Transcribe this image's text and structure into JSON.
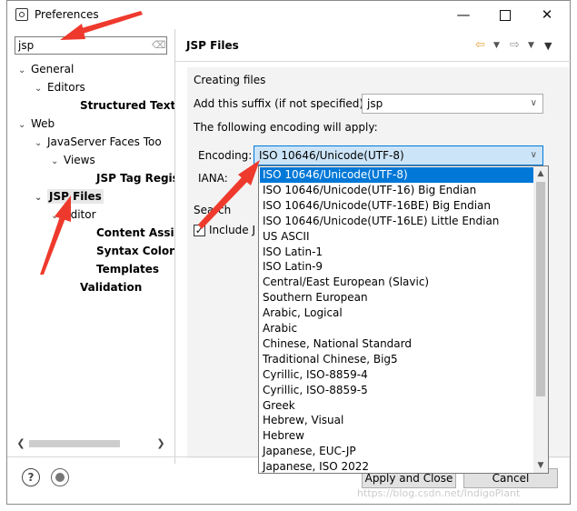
{
  "window": {
    "title": "Preferences",
    "minimize_label": "—",
    "close_label": "✕"
  },
  "filter": {
    "value": "jsp"
  },
  "tree": [
    {
      "label": "General",
      "twisty": "v",
      "bold": false
    },
    {
      "label": "Editors",
      "twisty": "v",
      "bold": false
    },
    {
      "label": "Structured Text E",
      "twisty": "",
      "bold": true
    },
    {
      "label": "Web",
      "twisty": "v",
      "bold": false
    },
    {
      "label": "JavaServer Faces Too",
      "twisty": "v",
      "bold": false
    },
    {
      "label": "Views",
      "twisty": "v",
      "bold": false
    },
    {
      "label": "JSP Tag Regis",
      "twisty": "",
      "bold": true
    },
    {
      "label": "JSP Files",
      "twisty": "v",
      "bold": true
    },
    {
      "label": "Editor",
      "twisty": "v",
      "bold": false
    },
    {
      "label": "Content Assis",
      "twisty": "",
      "bold": true
    },
    {
      "label": "Syntax Colorin",
      "twisty": "",
      "bold": true
    },
    {
      "label": "Templates",
      "twisty": "",
      "bold": true
    },
    {
      "label": "Validation",
      "twisty": "",
      "bold": true
    }
  ],
  "page": {
    "title": "JSP Files",
    "creating_files_label": "Creating files",
    "suffix_label": "Add this suffix (if not specified):",
    "suffix_value": "jsp",
    "encoding_info": "The following encoding will apply:",
    "encoding_label": "Encoding:",
    "encoding_value": "ISO 10646/Unicode(UTF-8)",
    "iana_label": "IANA:",
    "search_label": "Search",
    "include_label": "Include J",
    "apply_close_label": "Apply and Close",
    "cancel_label": "Cancel"
  },
  "encoding_options": [
    "ISO 10646/Unicode(UTF-8)",
    "ISO 10646/Unicode(UTF-16) Big Endian",
    "ISO 10646/Unicode(UTF-16BE) Big Endian",
    "ISO 10646/Unicode(UTF-16LE) Little Endian",
    "US ASCII",
    "ISO Latin-1",
    "ISO Latin-9",
    "Central/East European (Slavic)",
    "Southern European",
    "Arabic, Logical",
    "Arabic",
    "Chinese, National Standard",
    "Traditional Chinese, Big5",
    "Cyrillic, ISO-8859-4",
    "Cyrillic, ISO-8859-5",
    "Greek",
    "Hebrew, Visual",
    "Hebrew",
    "Japanese, EUC-JP",
    "Japanese, ISO 2022"
  ],
  "selected_encoding_index": 0,
  "watermark": "https://blog.csdn.net/IndigoPlant",
  "colors": {
    "selection": "#0078d7",
    "annotation_arrow": "#ee3a2d"
  }
}
